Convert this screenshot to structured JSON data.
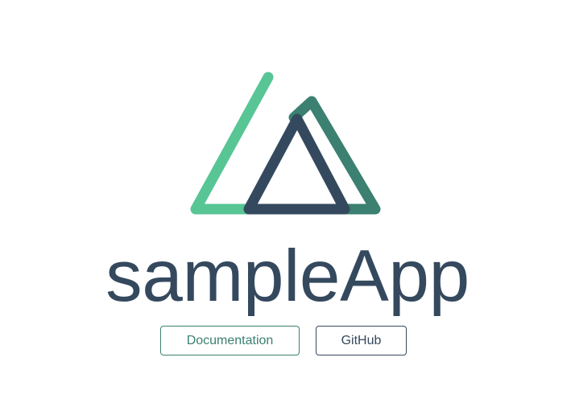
{
  "app": {
    "title": "sampleApp"
  },
  "links": {
    "documentation_label": "Documentation",
    "github_label": "GitHub"
  },
  "colors": {
    "primary_green": "#3b8070",
    "light_green": "#41b883",
    "text_dark": "#35495e"
  },
  "logo": {
    "icon_name": "nuxt-logo-icon"
  }
}
